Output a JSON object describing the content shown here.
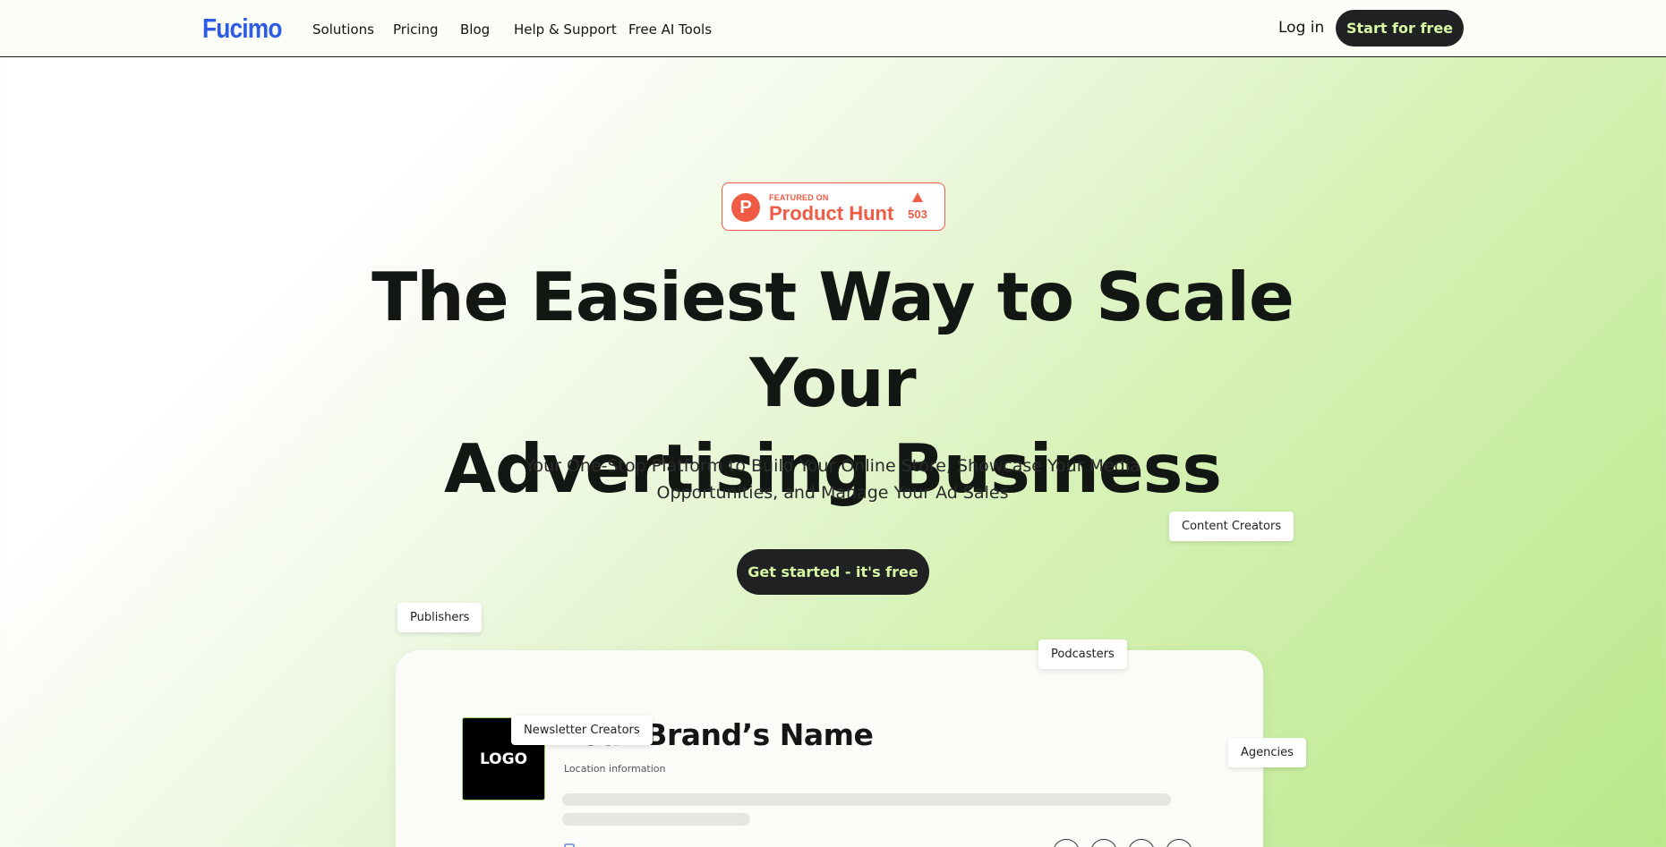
{
  "nav": {
    "logo": "Fucimo",
    "links": [
      "Solutions",
      "Pricing",
      "Blog",
      "Help & Support",
      "Free AI Tools"
    ],
    "login": "Log in",
    "start": "Start for free"
  },
  "badge": {
    "icon_letter": "P",
    "small": "FEATURED ON",
    "big": "Product Hunt",
    "count": "503",
    "icon": "upvote-triangle-icon"
  },
  "hero": {
    "title_line1": "The Easiest Way to Scale Your",
    "title_line2": "Advertising Business",
    "subtitle_line1": "Your One-Stop Platform to Build Your Online Store, Showcase Your Media",
    "subtitle_line2": "Opportunities, and Manage Your Ad Sales",
    "cta": "Get started - it's free"
  },
  "tags": {
    "content_creators": "Content Creators",
    "publishers": "Publishers",
    "podcasters": "Podcasters",
    "newsletter_creators": "Newsletter Creators",
    "agencies": "Agencies"
  },
  "card": {
    "logo_text": "LOGO",
    "brand_name": "Your Brand’s Name",
    "location": "Location information"
  },
  "colors": {
    "accent_blue": "#2d5be3",
    "dark_button": "#1f2122",
    "button_text": "#d7f7a5",
    "product_hunt": "#ef5b44",
    "gradient_green": "#b9e88a"
  }
}
